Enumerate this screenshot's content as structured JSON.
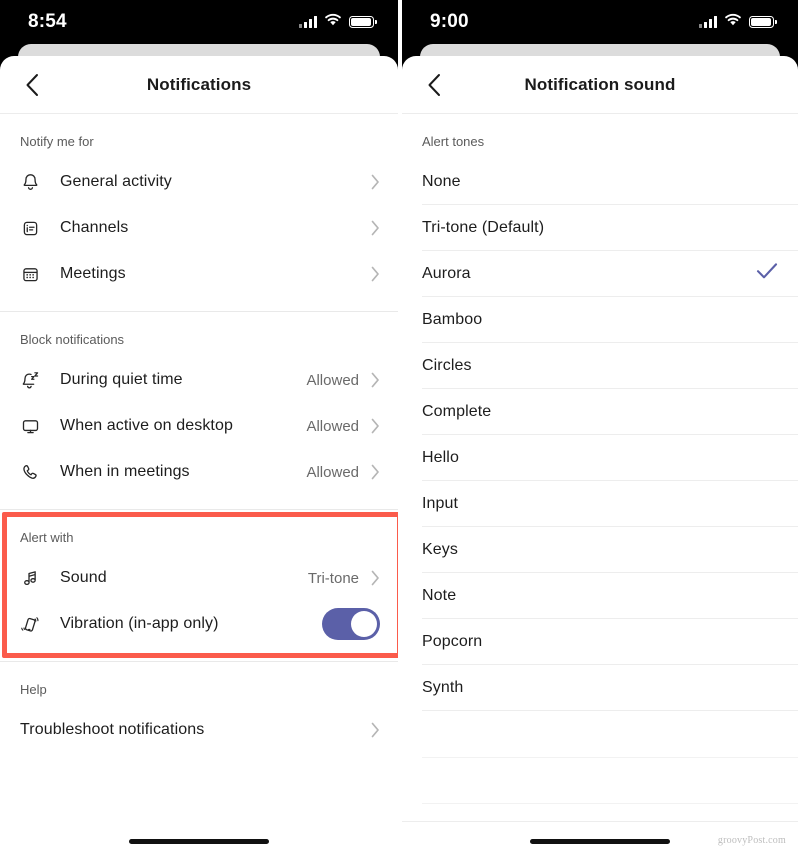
{
  "theme": {
    "accent_purple": "#5b60a8",
    "highlight_red": "#fb5b4b",
    "text_primary": "#1d1d1d",
    "text_secondary": "#6a6a6a",
    "section_header": "#5b5b5b",
    "divider": "#ececec",
    "status_bar_bg": "#000000"
  },
  "left_screen": {
    "status": {
      "time": "8:54",
      "signal_icon": "signal-bars-icon",
      "wifi_icon": "wifi-icon",
      "battery_icon": "battery-icon"
    },
    "nav": {
      "back_icon": "chevron-left-icon",
      "title": "Notifications"
    },
    "sections": [
      {
        "header": "Notify me for",
        "rows": [
          {
            "icon": "bell-icon",
            "label": "General activity",
            "value": "",
            "accessory": "chevron-right-icon"
          },
          {
            "icon": "channels-icon",
            "label": "Channels",
            "value": "",
            "accessory": "chevron-right-icon"
          },
          {
            "icon": "calendar-icon",
            "label": "Meetings",
            "value": "",
            "accessory": "chevron-right-icon"
          }
        ]
      },
      {
        "header": "Block notifications",
        "rows": [
          {
            "icon": "bell-sleep-icon",
            "label": "During quiet time",
            "value": "Allowed",
            "accessory": "chevron-right-icon"
          },
          {
            "icon": "desktop-monitor-icon",
            "label": "When active on desktop",
            "value": "Allowed",
            "accessory": "chevron-right-icon"
          },
          {
            "icon": "phone-call-icon",
            "label": "When in meetings",
            "value": "Allowed",
            "accessory": "chevron-right-icon"
          }
        ]
      },
      {
        "header": "Alert with",
        "highlighted": true,
        "rows": [
          {
            "icon": "music-note-icon",
            "label": "Sound",
            "value": "Tri-tone",
            "accessory": "chevron-right-icon"
          },
          {
            "icon": "vibration-icon",
            "label": "Vibration (in-app only)",
            "value": "",
            "accessory": "toggle-on"
          }
        ]
      },
      {
        "header": "Help",
        "rows": [
          {
            "icon": "",
            "label": "Troubleshoot notifications",
            "value": "",
            "accessory": "chevron-right-icon"
          }
        ]
      }
    ]
  },
  "right_screen": {
    "status": {
      "time": "9:00",
      "signal_icon": "signal-bars-icon",
      "wifi_icon": "wifi-icon",
      "battery_icon": "battery-icon"
    },
    "nav": {
      "back_icon": "chevron-left-icon",
      "title": "Notification sound"
    },
    "list_header": "Alert tones",
    "selected_tone": "Aurora",
    "check_icon": "checkmark-icon",
    "tones": [
      {
        "label": "None",
        "selected": false
      },
      {
        "label": "Tri-tone (Default)",
        "selected": false
      },
      {
        "label": "Aurora",
        "selected": true
      },
      {
        "label": "Bamboo",
        "selected": false
      },
      {
        "label": "Circles",
        "selected": false
      },
      {
        "label": "Complete",
        "selected": false
      },
      {
        "label": "Hello",
        "selected": false
      },
      {
        "label": "Input",
        "selected": false
      },
      {
        "label": "Keys",
        "selected": false
      },
      {
        "label": "Note",
        "selected": false
      },
      {
        "label": "Popcorn",
        "selected": false
      },
      {
        "label": "Synth",
        "selected": false
      }
    ],
    "watermark": "groovyPost.com"
  }
}
